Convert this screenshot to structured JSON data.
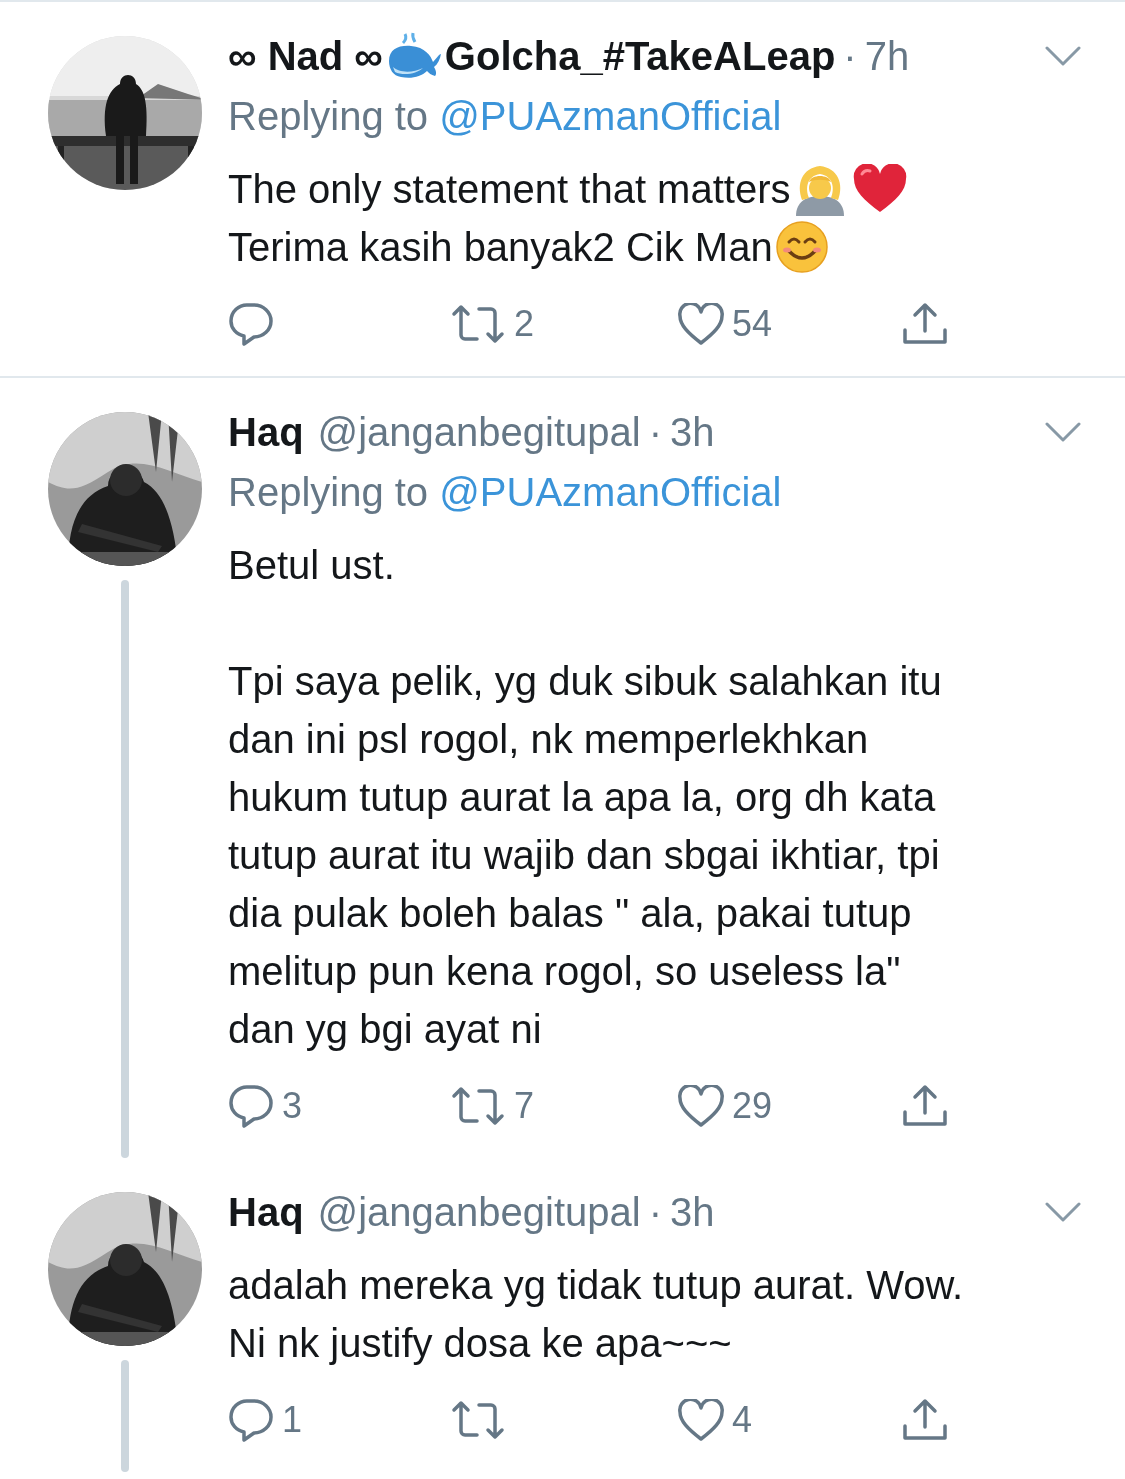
{
  "tweets": [
    {
      "avatar": {
        "kind": "picture"
      },
      "name_parts": [
        {
          "kind": "text",
          "text": "∞ Nad ∞"
        },
        {
          "kind": "whale"
        },
        {
          "kind": "text",
          "text": "Golcha_#TakeALeap"
        }
      ],
      "separator": "·",
      "time": "7h",
      "replying_to": {
        "label": "Replying to",
        "handle": "@PUAzmanOfficial"
      },
      "body": [
        [
          {
            "kind": "text",
            "text": "The only statement that matters"
          },
          {
            "kind": "gesture"
          },
          {
            "kind": "heart"
          }
        ],
        [
          {
            "kind": "text",
            "text": "Terima kasih banyak2 Cik Man"
          },
          {
            "kind": "smile"
          }
        ]
      ],
      "actions": [
        {
          "kind": "reply"
        },
        {
          "kind": "retweet",
          "count": "2"
        },
        {
          "kind": "like",
          "count": "54"
        },
        {
          "kind": "share"
        }
      ],
      "thread_line": false,
      "divider_below": true
    },
    {
      "avatar": {
        "kind": "picture"
      },
      "name_parts": [
        {
          "kind": "text",
          "text": "Haq"
        }
      ],
      "handle": "@janganbegitupal",
      "separator": "·",
      "time": "3h",
      "replying_to": {
        "label": "Replying to",
        "handle": "@PUAzmanOfficial"
      },
      "body": [
        [
          {
            "kind": "text",
            "text": "Betul ust.\n\nTpi saya pelik, yg duk sibuk salahkan itu\ndan ini psl rogol, nk memperlekhkan\nhukum tutup aurat la apa la, org dh kata\ntutup aurat itu wajib dan sbgai ikhtiar, tpi\ndia pulak boleh balas \" ala, pakai tutup\nmelitup pun kena rogol, so useless la\"\ndan yg bgi ayat ni"
          }
        ]
      ],
      "actions": [
        {
          "kind": "reply",
          "count": "3"
        },
        {
          "kind": "retweet",
          "count": "7"
        },
        {
          "kind": "like",
          "count": "29"
        },
        {
          "kind": "share"
        }
      ],
      "thread_line": true,
      "divider_below": false
    },
    {
      "avatar": {
        "kind": "picture"
      },
      "name_parts": [
        {
          "kind": "text",
          "text": "Haq"
        }
      ],
      "handle": "@janganbegitupal",
      "separator": "·",
      "time": "3h",
      "body": [
        [
          {
            "kind": "text",
            "text": "adalah mereka yg tidak tutup aurat. Wow.\nNi nk justify dosa ke apa~~~"
          }
        ]
      ],
      "actions": [
        {
          "kind": "reply",
          "count": "1"
        },
        {
          "kind": "retweet"
        },
        {
          "kind": "like",
          "count": "4"
        },
        {
          "kind": "share"
        }
      ],
      "thread_line": true,
      "divider_below": false
    }
  ]
}
